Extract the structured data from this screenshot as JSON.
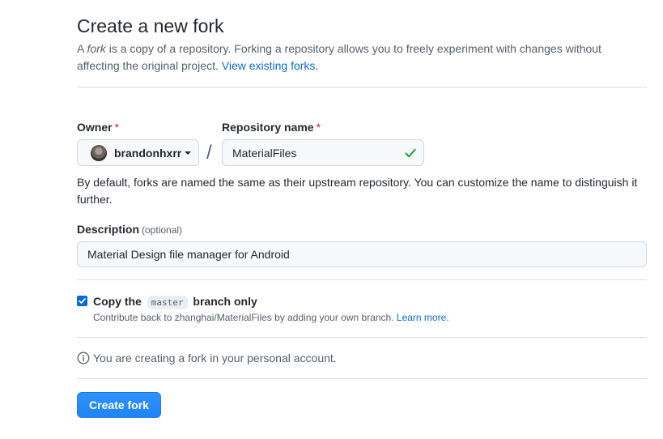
{
  "header": {
    "title": "Create a new fork",
    "intro_prefix": "A ",
    "intro_em": "fork",
    "intro_rest": " is a copy of a repository. Forking a repository allows you to freely experiment with changes without affecting the original project.",
    "view_forks_link": "View existing forks."
  },
  "owner": {
    "label": "Owner",
    "required_mark": "*",
    "selected": "brandonhxrr"
  },
  "separator": "/",
  "repository": {
    "label": "Repository name",
    "required_mark": "*",
    "value": "MaterialFiles",
    "valid": true
  },
  "help_text": "By default, forks are named the same as their upstream repository. You can customize the name to distinguish it further.",
  "description": {
    "label": "Description",
    "optional_label": "(optional)",
    "value": "Material Design file manager for Android"
  },
  "copy_branch": {
    "checked": true,
    "label_before": "Copy the",
    "branch": "master",
    "label_after": "branch only",
    "contribute_text": "Contribute back to zhanghai/MaterialFiles by adding your own branch.",
    "learn_more": "Learn more."
  },
  "info_text": "You are creating a fork in your personal account.",
  "create_button": "Create fork",
  "colors": {
    "accent": "#0969da",
    "primary_button": "#2188ff",
    "success": "#2da44e",
    "required": "#cf222e"
  },
  "icons": {
    "owner_avatar": "avatar",
    "owner_dropdown": "caret-down-icon",
    "repo_valid": "check-icon",
    "info": "info-icon",
    "checkbox": "checkbox-checked-icon"
  }
}
